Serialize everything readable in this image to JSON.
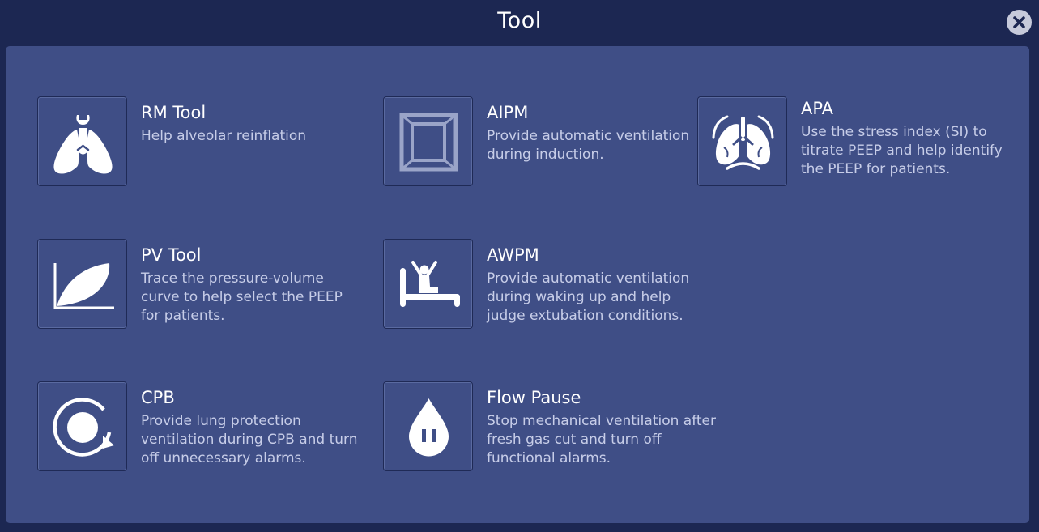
{
  "window": {
    "title": "Tool"
  },
  "tools": [
    {
      "name": "RM Tool",
      "description": "Help alveolar reinflation",
      "icon": "lungs-wrench-icon"
    },
    {
      "name": "AIPM",
      "description": "Provide automatic ventilation during induction.",
      "icon": "square-frame-icon"
    },
    {
      "name": "APA",
      "description": "Use the stress index (SI) to titrate PEEP and help identify the PEEP for patients.",
      "icon": "lungs-apa-icon"
    },
    {
      "name": "PV Tool",
      "description": "Trace the pressure-volume curve to help select the PEEP for patients.",
      "icon": "pv-curve-icon"
    },
    {
      "name": "AWPM",
      "description": "Provide automatic ventilation during waking up and help judge extubation conditions.",
      "icon": "patient-waking-icon"
    },
    {
      "name": "CPB",
      "description": "Provide lung protection ventilation during CPB and turn off unnecessary alarms.",
      "icon": "circular-bypass-icon"
    },
    {
      "name": "Flow Pause",
      "description": "Stop mechanical ventilation after fresh gas cut and turn off functional alarms.",
      "icon": "drop-pause-icon"
    }
  ],
  "colors": {
    "header_bg": "#1c2752",
    "panel_bg": "#3f4e86",
    "title_text": "#ffffff",
    "desc_text": "#c7cde8"
  }
}
